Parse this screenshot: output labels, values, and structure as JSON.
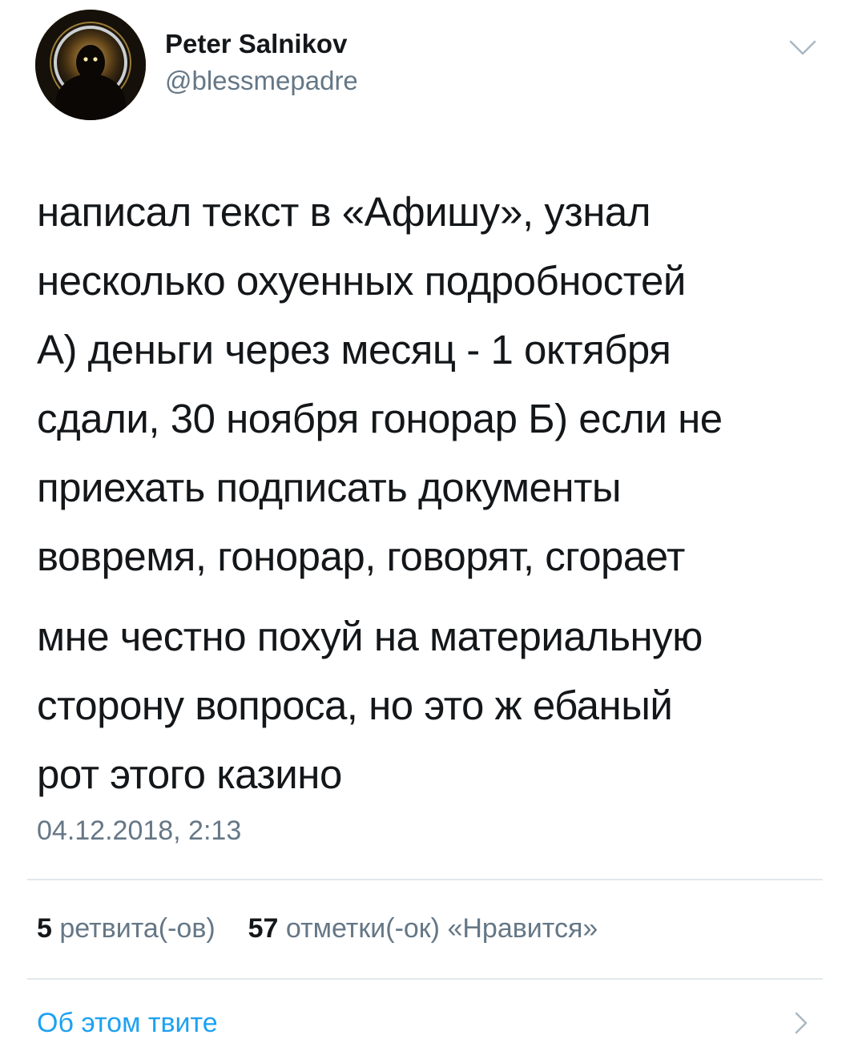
{
  "author": {
    "name": "Peter Salnikov",
    "handle": "@blessmepadre",
    "avatar_icon": "avatar-image"
  },
  "tweet": {
    "paragraph1": [
      "написал текст в «Афишу», узнал",
      "несколько охуенных подробностей",
      "А) деньги через месяц - 1 октября",
      "сдали, 30 ноября гонорар Б) если не",
      "приехать подписать документы",
      "вовремя, гонорар, говорят, сгорает"
    ],
    "paragraph2": [
      "мне честно похуй на материальную",
      "сторону вопроса, но это ж ебаный",
      "рот этого казино"
    ],
    "timestamp": "04.12.2018, 2:13"
  },
  "stats": {
    "retweets_count": "5",
    "retweets_label": "ретвита(-ов)",
    "likes_count": "57",
    "likes_label": "отметки(-ок) «Нравится»"
  },
  "footer": {
    "about_tweet_label": "Об этом твите"
  },
  "colors": {
    "text": "#14171a",
    "secondary": "#657786",
    "link": "#1da1f2",
    "divider": "#e1e8ed"
  }
}
